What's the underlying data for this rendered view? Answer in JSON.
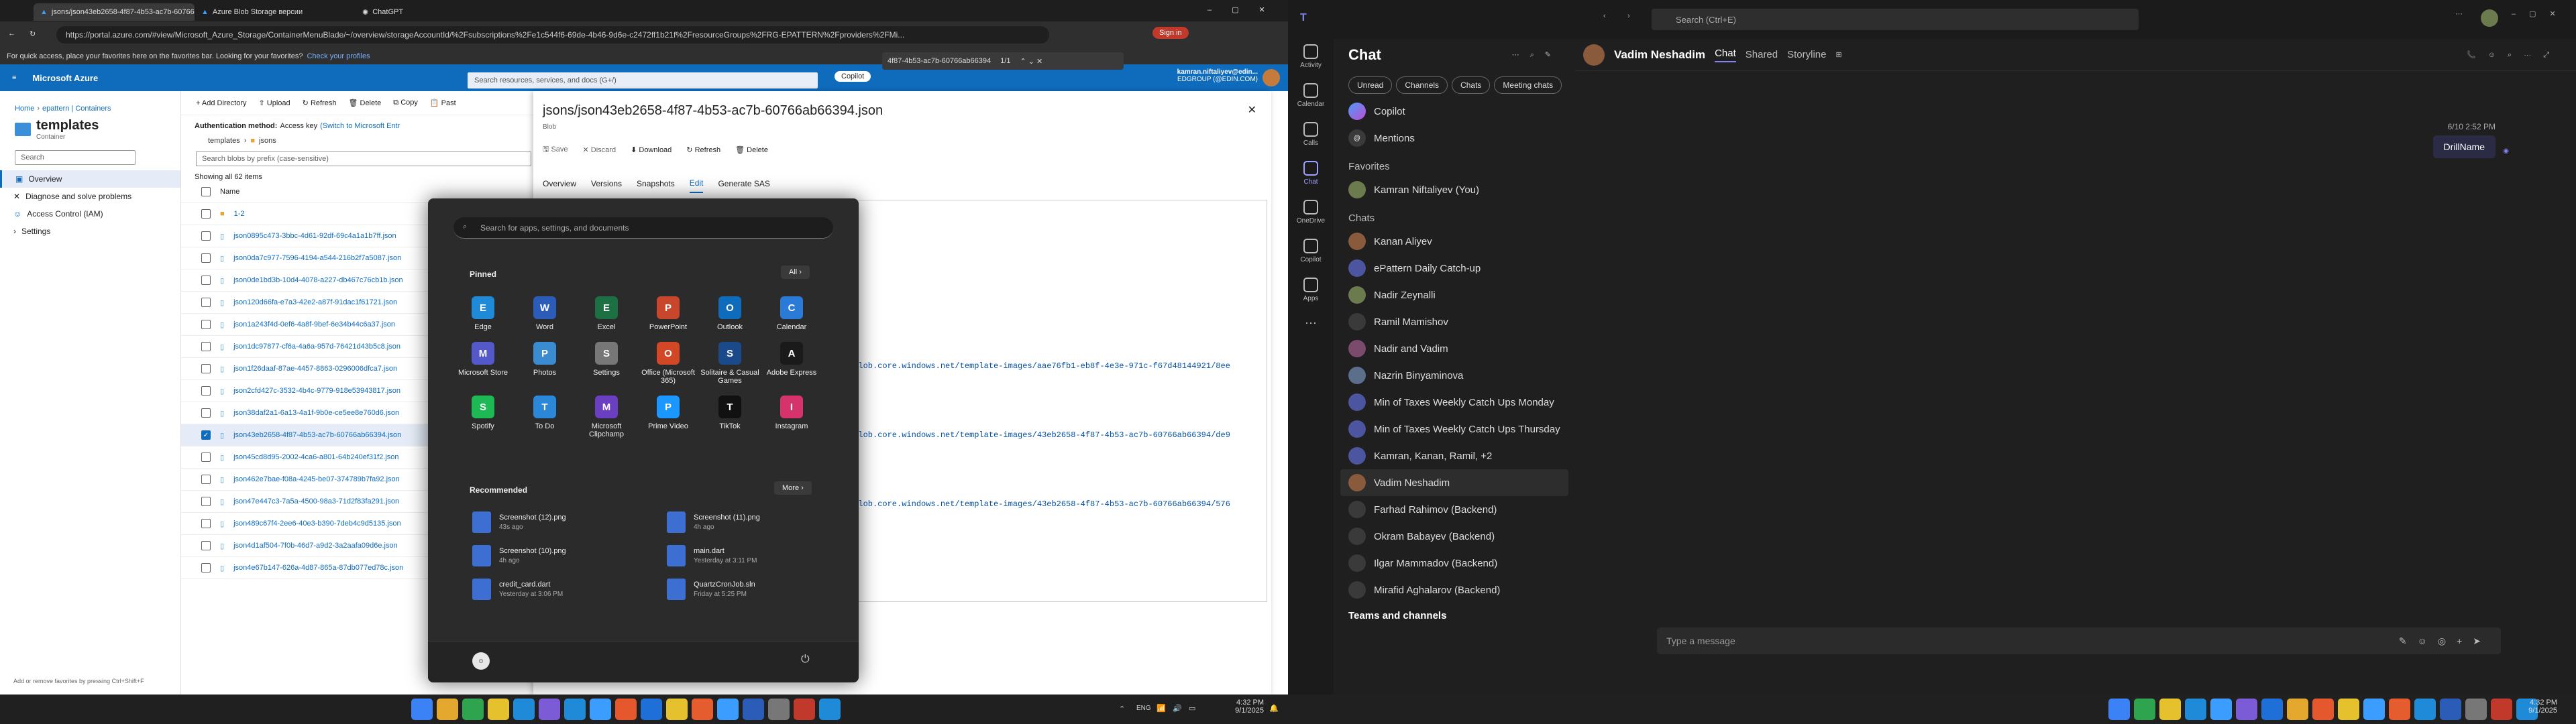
{
  "browser": {
    "tabs": [
      {
        "label": "jsons/json43eb2658-4f87-4b53-ac7b-60766ab66394.json",
        "active": true
      },
      {
        "label": "Azure Blob Storage версии",
        "active": false
      },
      {
        "label": "ChatGPT",
        "active": false
      }
    ],
    "url": "https://portal.azure.com/#view/Microsoft_Azure_Storage/ContainerMenuBlade/~/overview/storageAccountId/%2Fsubscriptions%2Fe1c544f6-69de-4b46-9d6e-c2472ff1b21f%2FresourceGroups%2FRG-EPATTERN%2Fproviders%2FMi...",
    "signin": "Sign in",
    "find_text": "4f87-4b53-ac7b-60766ab66394",
    "find_count": "1/1",
    "favbar_text": "For quick access, place your favorites here on the favorites bar. Looking for your favorites?",
    "favbar_link": "Check your profiles",
    "copilot": "Copilot"
  },
  "azure": {
    "brand": "Microsoft Azure",
    "search_placeholder": "Search resources, services, and docs (G+/)",
    "user_name": "kamran.niftaliyev@edin...",
    "user_dir": "EDGROUP (@EDIN.COM)",
    "breadcrumb": [
      "Home",
      "epattern | Containers"
    ],
    "container_title": "templates",
    "container_sub": "Container",
    "search": "Search",
    "nav": [
      "Overview",
      "Diagnose and solve problems",
      "Access Control (IAM)",
      "Settings"
    ],
    "toolbar": [
      "Add Directory",
      "Upload",
      "Refresh",
      "Delete",
      "Copy",
      "Past"
    ],
    "auth_label": "Authentication method:",
    "auth_value": "Access key",
    "auth_link": "(Switch to Microsoft Entr",
    "path": [
      "templates",
      "jsons"
    ],
    "blob_search": "Search blobs by prefix (case-sensitive)",
    "showing": "Showing all 62 items",
    "col_name": "Name",
    "rows": [
      "1-2",
      "json0895c473-3bbc-4d61-92df-69c4a1a1b7ff.json",
      "json0da7c977-7596-4194-a544-216b2f7a5087.json",
      "json0de1bd3b-10d4-4078-a227-db467c76cb1b.json",
      "json120d66fa-e7a3-42e2-a87f-91dac1f61721.json",
      "json1a243f4d-0ef6-4a8f-9bef-6e34b44c6a37.json",
      "json1dc97877-cf6a-4a6a-957d-76421d43b5c8.json",
      "json1f26daaf-87ae-4457-8863-0296006dfca7.json",
      "json2cfd427c-3532-4b4c-9779-918e53943817.json",
      "json38daf2a1-6a13-4a1f-9b0e-ce5ee8e760d6.json",
      "json43eb2658-4f87-4b53-ac7b-60766ab66394.json",
      "json45cd8d95-2002-4ca6-a801-64b240ef31f2.json",
      "json462e7bae-f08a-4245-be07-374789b7fa92.json",
      "json47e447c3-7a5a-4500-98a3-71d2f83fa291.json",
      "json489c67f4-2ee6-40e3-b390-7deb4c9d5135.json",
      "json4d1af504-7f0b-46d7-a9d2-3a2aafa09d6e.json",
      "json4e67b147-626a-4d87-865a-87db077ed78c.json"
    ],
    "add_fav": "Add or remove favorites by pressing Ctrl+Shift+F"
  },
  "blob": {
    "title": "jsons/json43eb2658-4f87-4b53-ac7b-60766ab66394.json",
    "subtitle": "Blob",
    "actions": [
      "Save",
      "Discard",
      "Download",
      "Refresh",
      "Delete"
    ],
    "tabs": [
      "Overview",
      "Versions",
      "Snapshots",
      "Edit",
      "Generate SAS"
    ],
    "code_lines": [
      ".blob.core.windows.net/template-images/aae76fb1-eb8f-4e3e-971c-f67d48144921/8ee",
      ".blob.core.windows.net/template-images/43eb2658-4f87-4b53-ac7b-60766ab66394/de9",
      ".blob.core.windows.net/template-images/43eb2658-4f87-4b53-ac7b-60766ab66394/576"
    ]
  },
  "start": {
    "search": "Search for apps, settings, and documents",
    "pinned": "Pinned",
    "all": "All",
    "apps": [
      {
        "name": "Edge",
        "color": "#1f8ad8"
      },
      {
        "name": "Word",
        "color": "#2b5cb8"
      },
      {
        "name": "Excel",
        "color": "#1d7044"
      },
      {
        "name": "PowerPoint",
        "color": "#c8462c"
      },
      {
        "name": "Outlook",
        "color": "#0f6cbd"
      },
      {
        "name": "Calendar",
        "color": "#2a7ad8"
      },
      {
        "name": "Microsoft Store",
        "color": "#5558c8"
      },
      {
        "name": "Photos",
        "color": "#3b8bd1"
      },
      {
        "name": "Settings",
        "color": "#777"
      },
      {
        "name": "Office (Microsoft 365)",
        "color": "#d24726"
      },
      {
        "name": "Solitaire & Casual Games",
        "color": "#1b4a8a"
      },
      {
        "name": "Adobe Express",
        "color": "#1a1a1a"
      },
      {
        "name": "Spotify",
        "color": "#1db954"
      },
      {
        "name": "To Do",
        "color": "#2b88d8"
      },
      {
        "name": "Microsoft Clipchamp",
        "color": "#6b3fc1"
      },
      {
        "name": "Prime Video",
        "color": "#1a98ff"
      },
      {
        "name": "TikTok",
        "color": "#111"
      },
      {
        "name": "Instagram",
        "color": "#d6336c"
      }
    ],
    "recommended": "Recommended",
    "more": "More",
    "recs": [
      {
        "name": "Screenshot (12).png",
        "time": "43s ago"
      },
      {
        "name": "Screenshot (11).png",
        "time": "4h ago"
      },
      {
        "name": "Screenshot (10).png",
        "time": "4h ago"
      },
      {
        "name": "main.dart",
        "time": "Yesterday at 3:11 PM"
      },
      {
        "name": "credit_card.dart",
        "time": "Yesterday at 3:06 PM"
      },
      {
        "name": "QuartzCronJob.sln",
        "time": "Friday at 5:25 PM"
      }
    ]
  },
  "taskbar1": {
    "lang": "ENG",
    "time": "4:32 PM",
    "date": "9/1/2025"
  },
  "teams": {
    "search": "Search (Ctrl+E)",
    "rail": [
      "Activity",
      "Calendar",
      "Calls",
      "Chat",
      "OneDrive",
      "Copilot",
      "Apps"
    ],
    "header": "Chat",
    "filters": [
      "Unread",
      "Channels",
      "Chats",
      "Meeting chats"
    ],
    "top": [
      "Copilot",
      "Mentions"
    ],
    "favorites": "Favorites",
    "fav_items": [
      "Kamran Niftaliyev (You)"
    ],
    "chats_label": "Chats",
    "chats": [
      "Kanan Aliyev",
      "ePattern Daily Catch-up",
      "Nadir Zeynalli",
      "Ramil Mamishov",
      "Nadir and Vadim",
      "Nazrin Binyaminova",
      "Min of Taxes Weekly Catch Ups Monday",
      "Min of Taxes Weekly Catch Ups Thursday",
      "Kamran, Kanan, Ramil, +2",
      "Vadim Neshadim",
      "Farhad Rahimov (Backend)",
      "Okram Babayev (Backend)",
      "Ilgar Mammadov (Backend)",
      "Mirafid Aghalarov (Backend)"
    ],
    "teams_channels": "Teams and channels",
    "contact": "Vadim Neshadim",
    "contact_tabs": [
      "Chat",
      "Shared",
      "Storyline"
    ],
    "msg_time": "6/10 2:52 PM",
    "msg_text": "DrillName",
    "compose": "Type a message"
  },
  "taskbar2": {
    "time": "4:32 PM",
    "date": "9/1/2025"
  }
}
